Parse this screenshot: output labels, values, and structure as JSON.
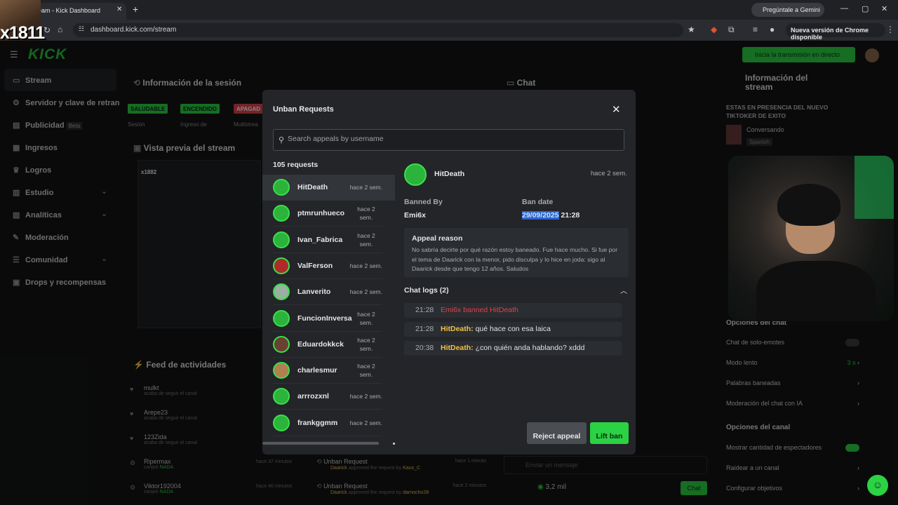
{
  "browser": {
    "tab_title": "eam - Kick Dashboard",
    "url": "dashboard.kick.com/stream",
    "gemini_label": "Pregúntale a Gemini",
    "update_label": "Nueva versión de Chrome disponible"
  },
  "webcam_overlay_text": "x1811",
  "dashboard": {
    "logo": "KICK",
    "go_live_label": "Inicia la transmisión en directo",
    "sidebar": [
      {
        "label": "Stream",
        "icon": "stream-icon"
      },
      {
        "label": "Servidor y clave de retran",
        "icon": "key-icon"
      },
      {
        "label": "Publicidad",
        "badge": "Beta",
        "icon": "ad-icon"
      },
      {
        "label": "Ingresos",
        "icon": "money-icon"
      },
      {
        "label": "Logros",
        "icon": "trophy-icon"
      },
      {
        "label": "Estudio",
        "icon": "studio-icon"
      },
      {
        "label": "Analíticas",
        "icon": "analytics-icon"
      },
      {
        "label": "Moderación",
        "icon": "moderation-icon"
      },
      {
        "label": "Comunidad",
        "icon": "community-icon"
      },
      {
        "label": "Drops y recompensas",
        "icon": "gift-icon"
      }
    ],
    "session_panel_title": "Información de la sesión",
    "status_pills": [
      "SALUDABLE",
      "ENCENDIDO",
      "APAGAD"
    ],
    "status_sublabels": [
      "Sesión",
      "Ingreso de",
      "Multistrea"
    ],
    "preview_title": "Vista previa del stream",
    "preview_tag": "x1882",
    "feed_title": "Feed de actividades",
    "feed": [
      {
        "user": "mulkt",
        "sub": "acaba de seguir el canal"
      },
      {
        "user": "Arepe23",
        "sub": "acaba de seguir el canal"
      },
      {
        "user": "123Zida",
        "sub": "acaba de seguir el canal"
      },
      {
        "user": "Ripermax",
        "sub": "canjeó",
        "reward": "NADA",
        "time": "hace 37 minutos"
      },
      {
        "user": "Viktor192004",
        "sub": "canjeó",
        "reward": "NADA",
        "time": "hace 40 minutos"
      }
    ],
    "unban_feed": [
      {
        "title": "Unban Request",
        "actor": "Daarick",
        "text": "approved the request by",
        "target": "Kaus_C",
        "time": "hace 1 minuto"
      },
      {
        "title": "Unban Request",
        "actor": "Daarick",
        "text": "approved the request by",
        "target": "darnocho28",
        "time": "hace 2 minutos"
      }
    ],
    "chat_title": "Chat",
    "chat_input_placeholder": "Enviar un mensaje",
    "viewers": "3,2 mil",
    "chat_button": "Chat",
    "stream_info_title": "Información del stream",
    "stream_title": "ESTAS EN PRESENCIA DEL NUEVO TIKTOKER DE EXITO",
    "stream_category": "Conversando",
    "stream_language": "Spanish",
    "chat_options_title": "Opciones del chat",
    "chat_options": [
      {
        "label": "Chat de solo-emotes",
        "type": "toggle",
        "on": false
      },
      {
        "label": "Modo lento",
        "value": "3 s"
      },
      {
        "label": "Palabras baneadas"
      },
      {
        "label": "Moderación del chat con IA"
      }
    ],
    "channel_options_title": "Opciones del canal",
    "channel_options": [
      {
        "label": "Mostrar cantidad de espectadores",
        "type": "toggle",
        "on": true
      },
      {
        "label": "Raidear a un canal"
      },
      {
        "label": "Configurar objetivos"
      }
    ]
  },
  "modal": {
    "title": "Unban Requests",
    "search_placeholder": "Search appeals by username",
    "count_label": "105 requests",
    "requests": [
      {
        "name": "HitDeath",
        "time": "hace 2 sem.",
        "selected": true
      },
      {
        "name": "ptmrunhueco",
        "time": "hace 2 sem."
      },
      {
        "name": "Ivan_Fabrica",
        "time": "hace 2 sem."
      },
      {
        "name": "ValFerson",
        "time": "hace 2 sem."
      },
      {
        "name": "Lanverito",
        "time": "hace 2 sem."
      },
      {
        "name": "FuncionInversa",
        "time": "hace 2 sem."
      },
      {
        "name": "Eduardokkck",
        "time": "hace 2 sem."
      },
      {
        "name": "charlesmur",
        "time": "hace 2 sem."
      },
      {
        "name": "arrrozxnl",
        "time": "hace 2 sem."
      },
      {
        "name": "frankggmm",
        "time": "hace 2 sem."
      }
    ],
    "detail": {
      "name": "HitDeath",
      "time": "hace 2 sem.",
      "banned_by_label": "Banned By",
      "banned_by": "Emi6x",
      "ban_date_label": "Ban date",
      "ban_date": "29/09/2025",
      "ban_time": "21:28",
      "appeal_title": "Appeal reason",
      "appeal_text": "No sabría decirte por qué razón estoy baneado. Fue hace mucho. Si fue por el tema de Daarick con la menor, pido disculpa y lo hice en joda: sigo al Daarick desde que tengo 12 años. Saludos",
      "chat_logs_label": "Chat logs (2)",
      "chat_logs": [
        {
          "time": "21:28",
          "system": "Emi6x banned HitDeath"
        },
        {
          "time": "21:28",
          "user": "HitDeath:",
          "msg": "qué hace con esa laica"
        },
        {
          "time": "20:38",
          "user": "HitDeath:",
          "msg": "¿con quién anda hablando? xddd"
        }
      ]
    },
    "reject_label": "Reject appeal",
    "lift_label": "Lift ban"
  },
  "colors": {
    "accent": "#2bd243",
    "danger": "#e0434b",
    "username": "#f2c14a"
  }
}
